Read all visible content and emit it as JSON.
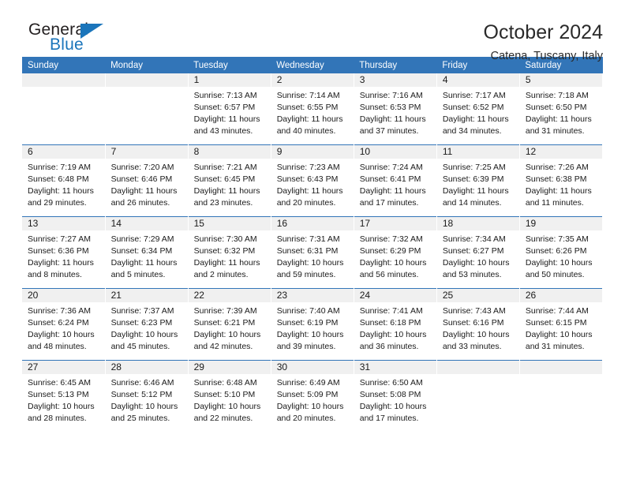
{
  "brand": {
    "name_part1": "General",
    "name_part2": "Blue",
    "triangle_color": "#1b75bb",
    "logo_icon": "triangle-flag-icon"
  },
  "header": {
    "title": "October 2024",
    "subtitle": "Catena, Tuscany, Italy"
  },
  "colors": {
    "header_blue": "#3275b8",
    "day_band_gray": "#f0f0f0",
    "brand_blue": "#1b75bb",
    "text": "#1a1a1a"
  },
  "weekdays": [
    "Sunday",
    "Monday",
    "Tuesday",
    "Wednesday",
    "Thursday",
    "Friday",
    "Saturday"
  ],
  "labels": {
    "sunrise": "Sunrise:",
    "sunset": "Sunset:",
    "daylight": "Daylight:"
  },
  "weeks": [
    [
      {
        "day": "",
        "sunrise": "",
        "sunset": "",
        "daylight": "",
        "daylight2": ""
      },
      {
        "day": "",
        "sunrise": "",
        "sunset": "",
        "daylight": "",
        "daylight2": ""
      },
      {
        "day": "1",
        "sunrise": "Sunrise: 7:13 AM",
        "sunset": "Sunset: 6:57 PM",
        "daylight": "Daylight: 11 hours",
        "daylight2": "and 43 minutes."
      },
      {
        "day": "2",
        "sunrise": "Sunrise: 7:14 AM",
        "sunset": "Sunset: 6:55 PM",
        "daylight": "Daylight: 11 hours",
        "daylight2": "and 40 minutes."
      },
      {
        "day": "3",
        "sunrise": "Sunrise: 7:16 AM",
        "sunset": "Sunset: 6:53 PM",
        "daylight": "Daylight: 11 hours",
        "daylight2": "and 37 minutes."
      },
      {
        "day": "4",
        "sunrise": "Sunrise: 7:17 AM",
        "sunset": "Sunset: 6:52 PM",
        "daylight": "Daylight: 11 hours",
        "daylight2": "and 34 minutes."
      },
      {
        "day": "5",
        "sunrise": "Sunrise: 7:18 AM",
        "sunset": "Sunset: 6:50 PM",
        "daylight": "Daylight: 11 hours",
        "daylight2": "and 31 minutes."
      }
    ],
    [
      {
        "day": "6",
        "sunrise": "Sunrise: 7:19 AM",
        "sunset": "Sunset: 6:48 PM",
        "daylight": "Daylight: 11 hours",
        "daylight2": "and 29 minutes."
      },
      {
        "day": "7",
        "sunrise": "Sunrise: 7:20 AM",
        "sunset": "Sunset: 6:46 PM",
        "daylight": "Daylight: 11 hours",
        "daylight2": "and 26 minutes."
      },
      {
        "day": "8",
        "sunrise": "Sunrise: 7:21 AM",
        "sunset": "Sunset: 6:45 PM",
        "daylight": "Daylight: 11 hours",
        "daylight2": "and 23 minutes."
      },
      {
        "day": "9",
        "sunrise": "Sunrise: 7:23 AM",
        "sunset": "Sunset: 6:43 PM",
        "daylight": "Daylight: 11 hours",
        "daylight2": "and 20 minutes."
      },
      {
        "day": "10",
        "sunrise": "Sunrise: 7:24 AM",
        "sunset": "Sunset: 6:41 PM",
        "daylight": "Daylight: 11 hours",
        "daylight2": "and 17 minutes."
      },
      {
        "day": "11",
        "sunrise": "Sunrise: 7:25 AM",
        "sunset": "Sunset: 6:39 PM",
        "daylight": "Daylight: 11 hours",
        "daylight2": "and 14 minutes."
      },
      {
        "day": "12",
        "sunrise": "Sunrise: 7:26 AM",
        "sunset": "Sunset: 6:38 PM",
        "daylight": "Daylight: 11 hours",
        "daylight2": "and 11 minutes."
      }
    ],
    [
      {
        "day": "13",
        "sunrise": "Sunrise: 7:27 AM",
        "sunset": "Sunset: 6:36 PM",
        "daylight": "Daylight: 11 hours",
        "daylight2": "and 8 minutes."
      },
      {
        "day": "14",
        "sunrise": "Sunrise: 7:29 AM",
        "sunset": "Sunset: 6:34 PM",
        "daylight": "Daylight: 11 hours",
        "daylight2": "and 5 minutes."
      },
      {
        "day": "15",
        "sunrise": "Sunrise: 7:30 AM",
        "sunset": "Sunset: 6:32 PM",
        "daylight": "Daylight: 11 hours",
        "daylight2": "and 2 minutes."
      },
      {
        "day": "16",
        "sunrise": "Sunrise: 7:31 AM",
        "sunset": "Sunset: 6:31 PM",
        "daylight": "Daylight: 10 hours",
        "daylight2": "and 59 minutes."
      },
      {
        "day": "17",
        "sunrise": "Sunrise: 7:32 AM",
        "sunset": "Sunset: 6:29 PM",
        "daylight": "Daylight: 10 hours",
        "daylight2": "and 56 minutes."
      },
      {
        "day": "18",
        "sunrise": "Sunrise: 7:34 AM",
        "sunset": "Sunset: 6:27 PM",
        "daylight": "Daylight: 10 hours",
        "daylight2": "and 53 minutes."
      },
      {
        "day": "19",
        "sunrise": "Sunrise: 7:35 AM",
        "sunset": "Sunset: 6:26 PM",
        "daylight": "Daylight: 10 hours",
        "daylight2": "and 50 minutes."
      }
    ],
    [
      {
        "day": "20",
        "sunrise": "Sunrise: 7:36 AM",
        "sunset": "Sunset: 6:24 PM",
        "daylight": "Daylight: 10 hours",
        "daylight2": "and 48 minutes."
      },
      {
        "day": "21",
        "sunrise": "Sunrise: 7:37 AM",
        "sunset": "Sunset: 6:23 PM",
        "daylight": "Daylight: 10 hours",
        "daylight2": "and 45 minutes."
      },
      {
        "day": "22",
        "sunrise": "Sunrise: 7:39 AM",
        "sunset": "Sunset: 6:21 PM",
        "daylight": "Daylight: 10 hours",
        "daylight2": "and 42 minutes."
      },
      {
        "day": "23",
        "sunrise": "Sunrise: 7:40 AM",
        "sunset": "Sunset: 6:19 PM",
        "daylight": "Daylight: 10 hours",
        "daylight2": "and 39 minutes."
      },
      {
        "day": "24",
        "sunrise": "Sunrise: 7:41 AM",
        "sunset": "Sunset: 6:18 PM",
        "daylight": "Daylight: 10 hours",
        "daylight2": "and 36 minutes."
      },
      {
        "day": "25",
        "sunrise": "Sunrise: 7:43 AM",
        "sunset": "Sunset: 6:16 PM",
        "daylight": "Daylight: 10 hours",
        "daylight2": "and 33 minutes."
      },
      {
        "day": "26",
        "sunrise": "Sunrise: 7:44 AM",
        "sunset": "Sunset: 6:15 PM",
        "daylight": "Daylight: 10 hours",
        "daylight2": "and 31 minutes."
      }
    ],
    [
      {
        "day": "27",
        "sunrise": "Sunrise: 6:45 AM",
        "sunset": "Sunset: 5:13 PM",
        "daylight": "Daylight: 10 hours",
        "daylight2": "and 28 minutes."
      },
      {
        "day": "28",
        "sunrise": "Sunrise: 6:46 AM",
        "sunset": "Sunset: 5:12 PM",
        "daylight": "Daylight: 10 hours",
        "daylight2": "and 25 minutes."
      },
      {
        "day": "29",
        "sunrise": "Sunrise: 6:48 AM",
        "sunset": "Sunset: 5:10 PM",
        "daylight": "Daylight: 10 hours",
        "daylight2": "and 22 minutes."
      },
      {
        "day": "30",
        "sunrise": "Sunrise: 6:49 AM",
        "sunset": "Sunset: 5:09 PM",
        "daylight": "Daylight: 10 hours",
        "daylight2": "and 20 minutes."
      },
      {
        "day": "31",
        "sunrise": "Sunrise: 6:50 AM",
        "sunset": "Sunset: 5:08 PM",
        "daylight": "Daylight: 10 hours",
        "daylight2": "and 17 minutes."
      },
      {
        "day": "",
        "sunrise": "",
        "sunset": "",
        "daylight": "",
        "daylight2": ""
      },
      {
        "day": "",
        "sunrise": "",
        "sunset": "",
        "daylight": "",
        "daylight2": ""
      }
    ]
  ]
}
